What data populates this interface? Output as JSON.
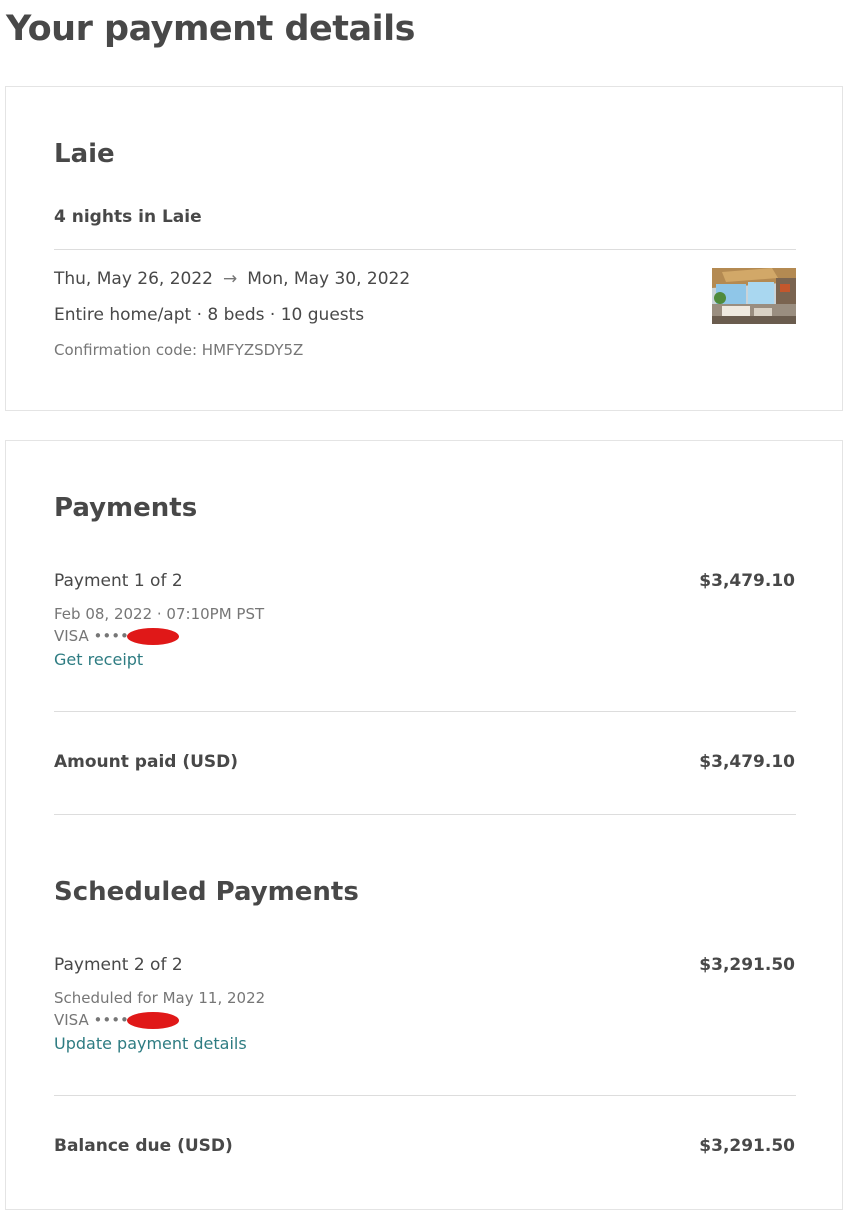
{
  "page": {
    "title": "Your payment details"
  },
  "trip": {
    "title": "Laie",
    "subtitle": "4 nights in Laie",
    "check_in": "Thu, May 26, 2022",
    "arrow": "→",
    "check_out": "Mon, May 30, 2022",
    "listing_info": "Entire home/apt · 8 beds · 10 guests",
    "confirmation": "Confirmation code: HMFYZSDY5Z"
  },
  "payments": {
    "title": "Payments",
    "items": [
      {
        "label": "Payment 1 of 2",
        "amount": "$3,479.10",
        "date": "Feb 08, 2022 · 07:10PM PST",
        "card": "VISA ••••",
        "link": "Get receipt"
      }
    ],
    "total_label": "Amount paid (USD)",
    "total_amount": "$3,479.10"
  },
  "scheduled": {
    "title": "Scheduled Payments",
    "items": [
      {
        "label": "Payment 2 of 2",
        "amount": "$3,291.50",
        "date": "Scheduled for May 11, 2022",
        "card": "VISA ••••",
        "link": "Update payment details"
      }
    ],
    "total_label": "Balance due (USD)",
    "total_amount": "$3,291.50"
  },
  "colors": {
    "text": "#484848",
    "muted": "#767676",
    "link": "#2e7c82",
    "divider": "#dddddd",
    "redaction": "#e01818"
  }
}
